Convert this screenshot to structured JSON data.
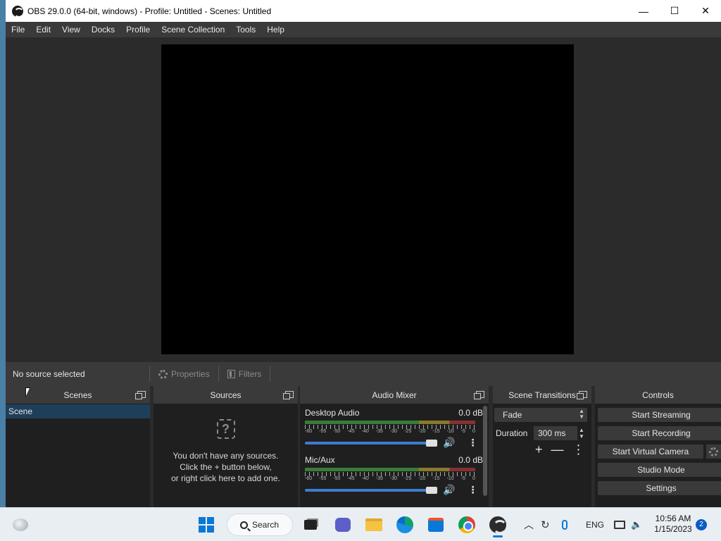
{
  "window": {
    "title": "OBS 29.0.0 (64-bit, windows) - Profile: Untitled - Scenes: Untitled",
    "controls": {
      "minimize": "—",
      "maximize": "☐",
      "close": "✕"
    }
  },
  "menu": [
    "File",
    "Edit",
    "View",
    "Docks",
    "Profile",
    "Scene Collection",
    "Tools",
    "Help"
  ],
  "source_toolbar": {
    "no_source": "No source selected",
    "properties": "Properties",
    "filters": "Filters"
  },
  "docks": {
    "scenes": {
      "title": "Scenes",
      "items": [
        "Scene"
      ]
    },
    "sources": {
      "title": "Sources",
      "empty_icon": "?",
      "empty_lines": [
        "You don't have any sources.",
        "Click the + button below,",
        "or right click here to add one."
      ]
    },
    "mixer": {
      "title": "Audio Mixer",
      "tick_labels": [
        "-60",
        "-55",
        "-50",
        "-45",
        "-40",
        "-35",
        "-30",
        "-25",
        "-20",
        "-15",
        "-10",
        "-5",
        "0"
      ],
      "channels": [
        {
          "name": "Desktop Audio",
          "level": "0.0 dB"
        },
        {
          "name": "Mic/Aux",
          "level": "0.0 dB"
        }
      ]
    },
    "transitions": {
      "title": "Scene Transitions",
      "selected": "Fade",
      "duration_label": "Duration",
      "duration_value": "300 ms",
      "add": "+",
      "remove": "—",
      "more": "⋮"
    },
    "controls": {
      "title": "Controls",
      "start_streaming": "Start Streaming",
      "start_recording": "Start Recording",
      "start_virtual_camera": "Start Virtual Camera",
      "studio_mode": "Studio Mode",
      "settings": "Settings"
    }
  },
  "taskbar": {
    "search_label": "Search",
    "language": "ENG",
    "time": "10:56 AM",
    "date": "1/15/2023",
    "notifications": "2"
  }
}
